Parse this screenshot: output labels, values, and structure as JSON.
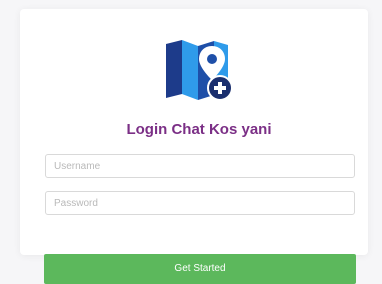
{
  "login": {
    "title": "Login Chat Kos yani",
    "username_placeholder": "Username",
    "password_placeholder": "Password",
    "submit_label": "Get Started"
  },
  "colors": {
    "title": "#7b2f86",
    "button": "#5cb85c",
    "map_dark": "#1d3b8a",
    "map_light": "#2f9bea"
  },
  "icons": {
    "logo": "map-pin-plus-icon"
  }
}
